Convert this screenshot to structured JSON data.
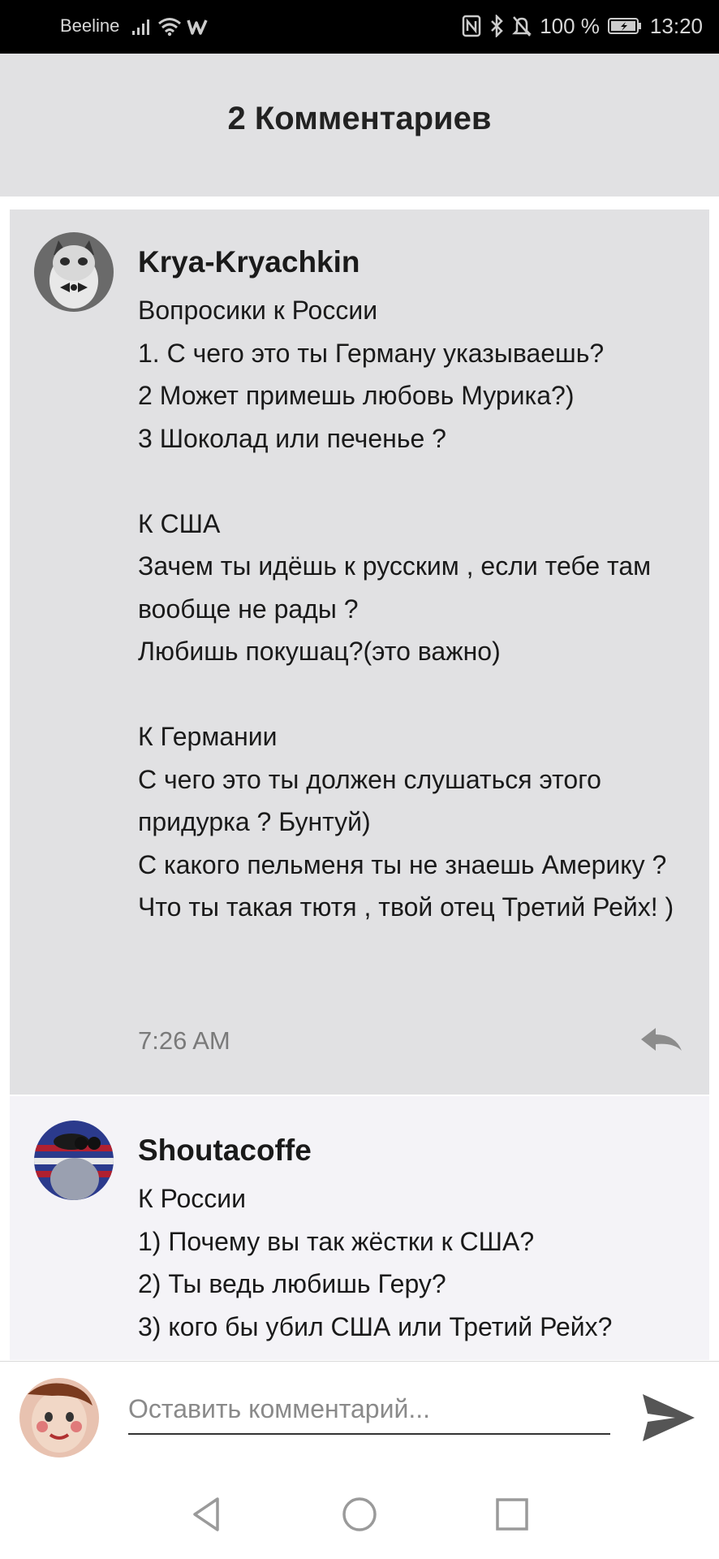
{
  "status_bar": {
    "carrier": "Beeline",
    "battery": "100 %",
    "time": "13:20"
  },
  "header": {
    "title": "2 Комментариев"
  },
  "comments": [
    {
      "author": "Krya-Kryachkin",
      "text": "Вопросики к России\n1. С чего это ты Герману указываешь?\n2 Может примешь любовь Мурика?)\n3 Шоколад или печенье ?\n\nК США\nЗачем ты идёшь к русским , если тебе там вообще не рады ?\nЛюбишь покушац?(это важно)\n\nК Германии\nС чего это ты должен слушаться этого придурка ? Бунтуй)\nС какого пельменя ты не знаешь Америку ?\nЧто ты такая тютя , твой отец Третий Рейх! )",
      "time": "7:26 AM"
    },
    {
      "author": "Shoutacoffe",
      "text": "К России\n1) Почему  вы так жёстки к  США?\n2) Ты ведь любишь Геру?\n3) кого бы убил США или  Третий Рейх?"
    }
  ],
  "input": {
    "placeholder": "Оставить комментарий..."
  },
  "colors": {
    "status_bar": "#000000",
    "header_bg": "#e1e1e3",
    "highlighted_comment_bg": "#e1e1e3",
    "comment_bg": "#f4f3f7",
    "send_icon": "#555555"
  }
}
